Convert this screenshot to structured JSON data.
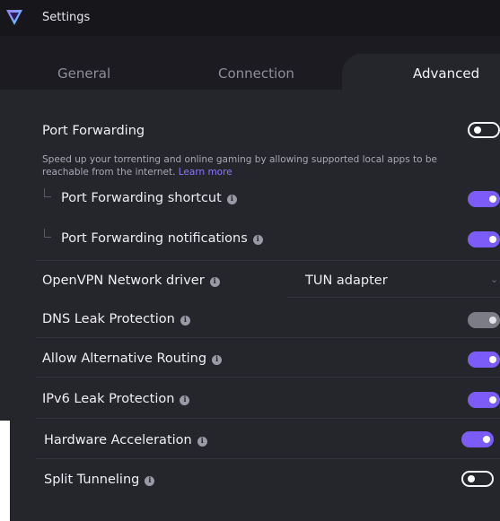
{
  "window": {
    "title": "Settings"
  },
  "tabs": [
    {
      "label": "General"
    },
    {
      "label": "Connection"
    },
    {
      "label": "Advanced",
      "active": true
    }
  ],
  "port_forwarding": {
    "label": "Port Forwarding",
    "enabled": false,
    "description": "Speed up your torrenting and online gaming by allowing supported local apps to be reachable from the internet.",
    "learn_more": "Learn more",
    "shortcut": {
      "label": "Port Forwarding shortcut",
      "enabled": true
    },
    "notifications": {
      "label": "Port Forwarding notifications",
      "enabled": true
    }
  },
  "openvpn_driver": {
    "label": "OpenVPN Network driver",
    "value": "TUN adapter"
  },
  "dns_leak": {
    "label": "DNS Leak Protection",
    "enabled": true,
    "disabled": true
  },
  "alt_routing": {
    "label": "Allow Alternative Routing",
    "enabled": true
  },
  "ipv6_leak": {
    "label": "IPv6 Leak Protection",
    "enabled": true
  },
  "hw_accel": {
    "label": "Hardware Acceleration",
    "enabled": true
  },
  "split_tunneling": {
    "label": "Split Tunneling",
    "enabled": false
  },
  "icons": [
    "app-logo-icon",
    "info-icon",
    "chevron-down-icon"
  ],
  "colors": {
    "accent": "#7b5cf8",
    "background": "#25252c",
    "titlebar": "#16161b",
    "link": "#8a75ff"
  }
}
